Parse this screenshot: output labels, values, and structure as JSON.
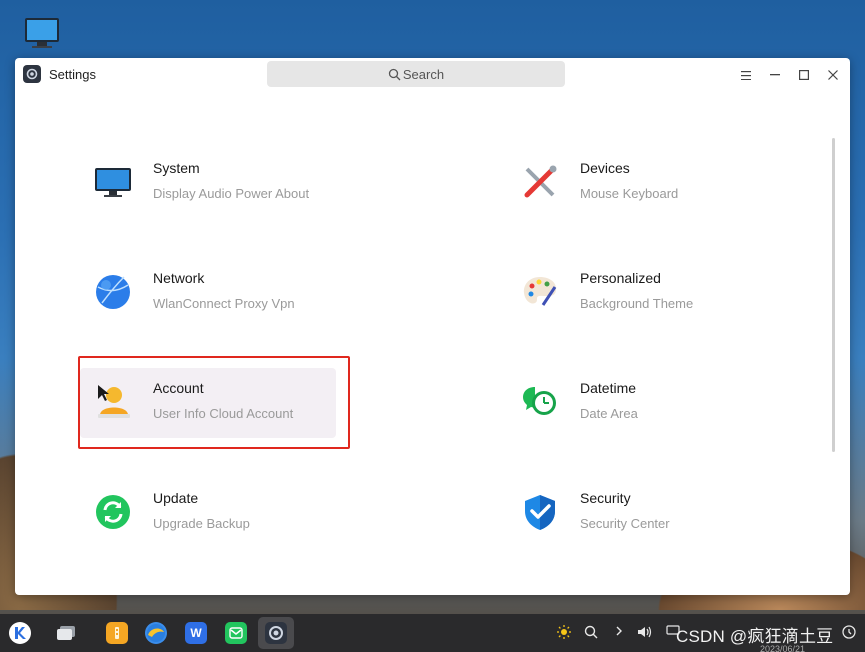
{
  "window": {
    "title": "Settings",
    "search_placeholder": "Search",
    "menu_icon": "hamburger-icon",
    "minimize_icon": "minimize-icon",
    "maximize_icon": "maximize-icon",
    "close_icon": "close-icon"
  },
  "categories": [
    {
      "title": "System",
      "subtitle": "Display Audio Power About",
      "icon": "monitor-icon"
    },
    {
      "title": "Devices",
      "subtitle": "Mouse Keyboard",
      "icon": "tools-icon"
    },
    {
      "title": "Network",
      "subtitle": "WlanConnect Proxy Vpn",
      "icon": "globe-icon"
    },
    {
      "title": "Personalized",
      "subtitle": "Background Theme",
      "icon": "palette-icon"
    },
    {
      "title": "Account",
      "subtitle": "User Info Cloud Account",
      "icon": "user-icon",
      "selected": true
    },
    {
      "title": "Datetime",
      "subtitle": "Date Area",
      "icon": "clock-icon"
    },
    {
      "title": "Update",
      "subtitle": "Upgrade Backup",
      "icon": "refresh-icon"
    },
    {
      "title": "Security",
      "subtitle": "Security Center",
      "icon": "shield-icon"
    }
  ],
  "colors": {
    "highlight_border": "#e0281e",
    "selected_card_bg": "#f3eff4",
    "subtitle_text": "#9a9a9a",
    "taskbar_bg": "#2a2a2c"
  },
  "taskbar": {
    "apps": [
      "start-menu-icon",
      "multitask-view-icon",
      "file-manager-icon",
      "browser-icon",
      "wps-office-icon",
      "wechat-icon",
      "settings-icon"
    ],
    "wps_label": "W",
    "tray_icons": [
      "brightness-icon",
      "search-icon",
      "chevron-right-icon",
      "volume-icon",
      "screen-icon",
      "battery-icon",
      "notification-icon"
    ],
    "watermark": "CSDN @疯狂滴土豆",
    "clock_text": "2023/06/21"
  }
}
